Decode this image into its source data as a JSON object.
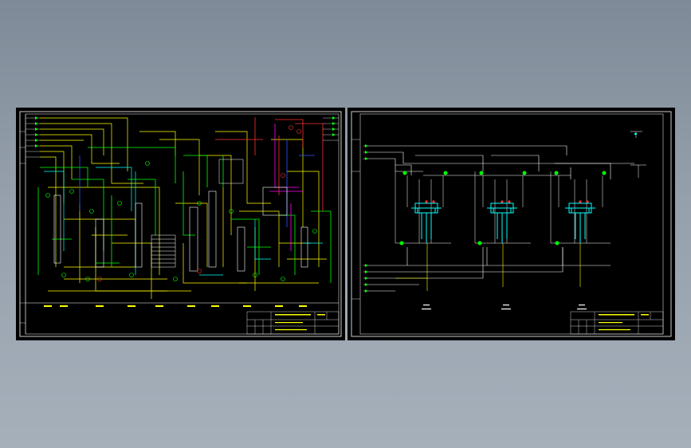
{
  "viewer": {
    "background_top": "#7f8a98",
    "background_bottom": "#a6b0bb",
    "sheet_color": "#000000",
    "frame_color": "#ffffff"
  },
  "drawing_palette": {
    "process_line": "#ffff00",
    "steam_line": "#00ff00",
    "water_line": "#00ffff",
    "hot_line": "#ff3030",
    "utility_line": "#ff00ff",
    "blue_line": "#3355ff",
    "frame_line": "#ffffff"
  },
  "sheets": [
    {
      "id": "left",
      "type": "process-flow-diagram"
    },
    {
      "id": "right",
      "type": "piping-diagram"
    }
  ]
}
